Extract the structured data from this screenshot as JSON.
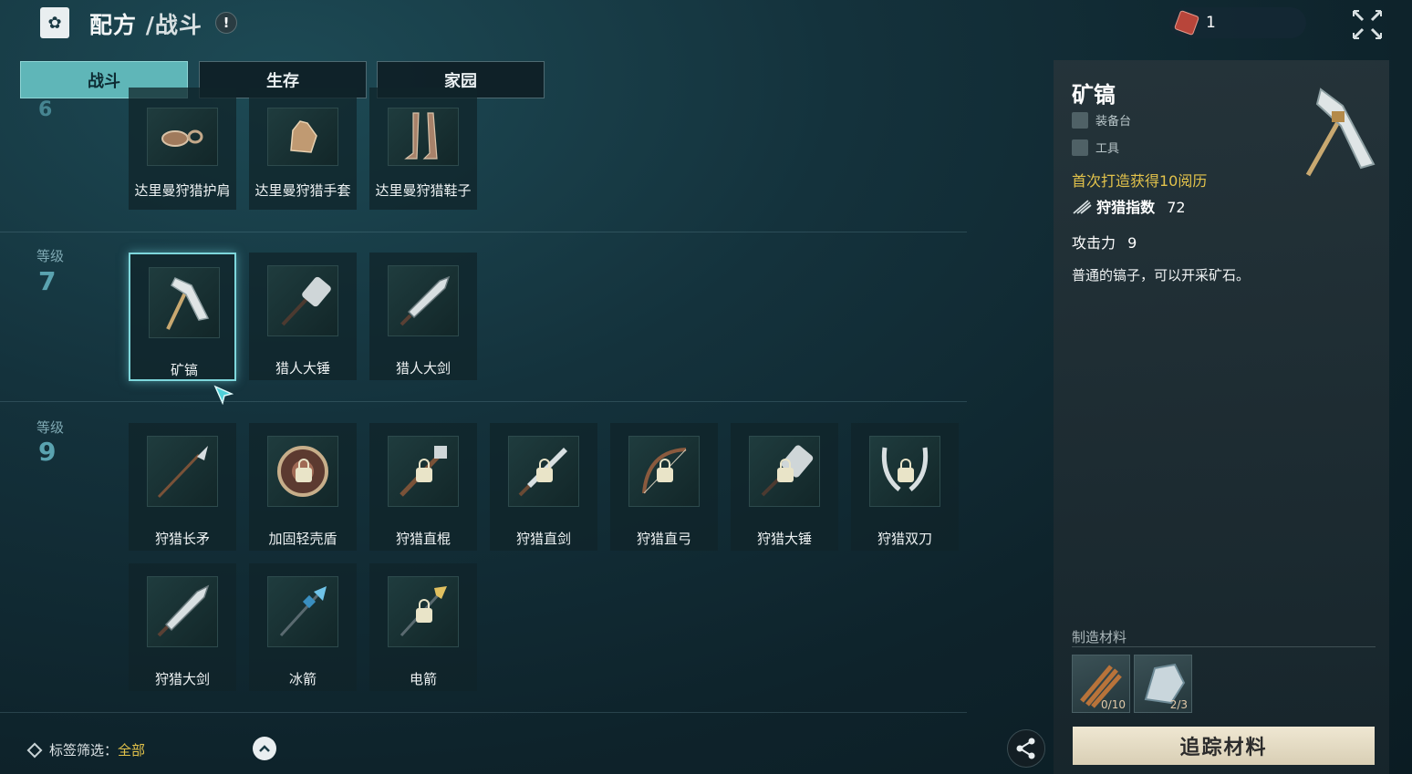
{
  "header": {
    "title_main": "配方",
    "title_sub": "/战斗",
    "warn_symbol": "!"
  },
  "currency": {
    "count": "1"
  },
  "tabs": [
    {
      "label": "战斗",
      "active": true
    },
    {
      "label": "生存",
      "active": false
    },
    {
      "label": "家园",
      "active": false
    }
  ],
  "levels": [
    {
      "label": "等级",
      "number": "7"
    },
    {
      "label": "等级",
      "number": "9"
    }
  ],
  "partial_level_number": "6",
  "items_row_top": [
    "达里曼狩猎护肩",
    "达里曼狩猎手套",
    "达里曼狩猎鞋子"
  ],
  "items_level7": [
    "矿镐",
    "猎人大锤",
    "猎人大剑"
  ],
  "items_level9_row1": [
    "狩猎长矛",
    "加固轻壳盾",
    "狩猎直棍",
    "狩猎直剑",
    "狩猎直弓",
    "狩猎大锤",
    "狩猎双刀"
  ],
  "items_level9_row2": [
    "狩猎大剑",
    "冰箭",
    "电箭"
  ],
  "detail": {
    "title": "矿镐",
    "station": "装备台",
    "category": "工具",
    "first_craft": "首次打造获得10阅历",
    "hunt_label": "狩猎指数",
    "hunt_value": "72",
    "atk_label": "攻击力",
    "atk_value": "9",
    "description": "普通的镐子，可以开采矿石。",
    "materials_title": "制造材料",
    "materials": [
      {
        "count": "0/10"
      },
      {
        "count": "2/3"
      }
    ],
    "track_button": "追踪材料"
  },
  "filter": {
    "label": "标签筛选：",
    "value": "全部"
  },
  "colors": {
    "accent": "#5fb6b8",
    "yellow": "#e3c34b",
    "bg": "#14323c"
  }
}
